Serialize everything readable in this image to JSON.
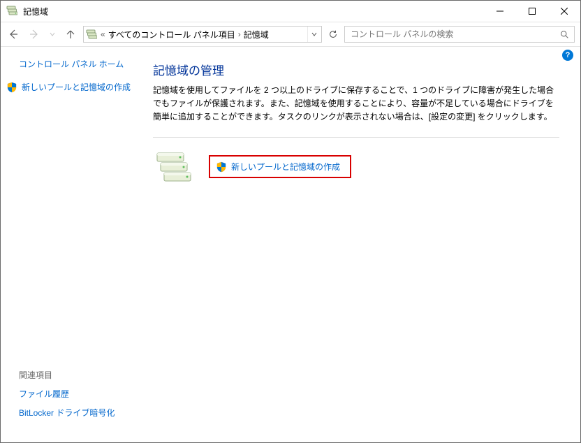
{
  "titlebar": {
    "title": "記憶域"
  },
  "nav": {
    "breadcrumb_prefix": "«",
    "breadcrumb_item1": "すべてのコントロール パネル項目",
    "breadcrumb_item2": "記憶域"
  },
  "search": {
    "placeholder": "コントロール パネルの検索"
  },
  "sidebar": {
    "home": "コントロール パネル ホーム",
    "create_link": "新しいプールと記憶域の作成",
    "related_label": "関連項目",
    "file_history": "ファイル履歴",
    "bitlocker": "BitLocker ドライブ暗号化"
  },
  "content": {
    "heading": "記憶域の管理",
    "description": "記憶域を使用してファイルを 2 つ以上のドライブに保存することで、1 つのドライブに障害が発生した場合でもファイルが保護されます。また、記憶域を使用することにより、容量が不足している場合にドライブを簡単に追加することができます。タスクのリンクが表示されない場合は、[設定の変更] をクリックします。",
    "action_link": "新しいプールと記憶域の作成"
  },
  "help": "?"
}
